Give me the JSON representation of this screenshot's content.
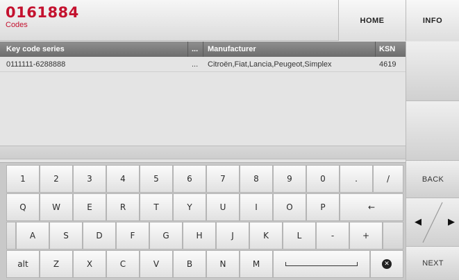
{
  "header": {
    "code": "0161884",
    "subtitle": "Codes",
    "home_label": "HOME",
    "info_label": "INFO"
  },
  "table": {
    "columns": [
      "Key code series",
      "...",
      "Manufacturer",
      "KSN"
    ],
    "rows": [
      [
        "0111111-6288888",
        "...",
        "Citroën,Fiat,Lancia,Peugeot,Simplex",
        "4619"
      ]
    ]
  },
  "side": {
    "back_label": "BACK",
    "next_label": "NEXT",
    "left_arrow": "◀",
    "right_arrow": "▶"
  },
  "keyboard": {
    "row1": [
      "1",
      "2",
      "3",
      "4",
      "5",
      "6",
      "7",
      "8",
      "9",
      "0",
      ".",
      "/"
    ],
    "row2": [
      "Q",
      "W",
      "E",
      "R",
      "T",
      "Y",
      "U",
      "I",
      "O",
      "P",
      "←"
    ],
    "row3": [
      "A",
      "S",
      "D",
      "F",
      "G",
      "H",
      "J",
      "K",
      "L",
      "-",
      "+"
    ],
    "row4": [
      "alt",
      "Z",
      "X",
      "C",
      "V",
      "B",
      "N",
      "M"
    ],
    "delete_glyph": "✕"
  }
}
